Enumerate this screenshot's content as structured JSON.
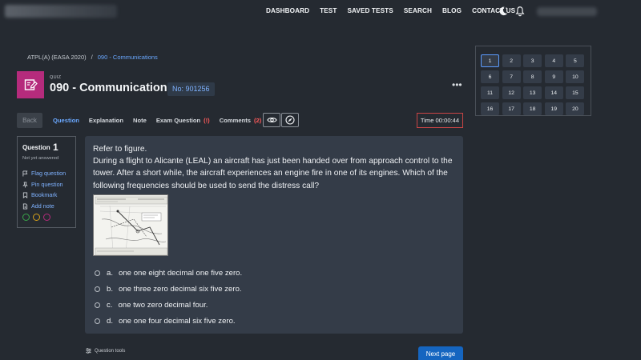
{
  "nav": {
    "items": [
      "DASHBOARD",
      "TEST",
      "SAVED TESTS",
      "SEARCH",
      "BLOG",
      "CONTACT US"
    ]
  },
  "breadcrumb": {
    "root": "ATPL(A) (EASA 2020)",
    "separator": "/",
    "current": "090 - Communications"
  },
  "quiz": {
    "tag": "QUIZ",
    "title": "090 - Communications",
    "number": "No: 901256"
  },
  "toolbar": {
    "back_label": "Back",
    "tabs": [
      "Question",
      "Explanation",
      "Note",
      "Exam Question",
      "Comments"
    ],
    "exam_question_badge": "(!)",
    "comments_badge": "(2)",
    "timer": "Time 00:00:44"
  },
  "question_info": {
    "label": "Question",
    "number": "1",
    "status": "Not yet answered",
    "links": [
      "Flag question",
      "Pin question",
      "Bookmark",
      "Add note"
    ],
    "circle_colors": [
      "#3aa64a",
      "#d8a21a",
      "#b52b7c"
    ]
  },
  "question": {
    "lines": [
      "Refer to figure.",
      "During a flight to Alicante (LEAL) an aircraft has just been handed over from approach control to the tower. After a short while, the aircraft experiences an engine fire in one of its engines. Which of the following frequencies should be used to send the distress call?"
    ],
    "answers": [
      {
        "letter": "a.",
        "text": "one one eight decimal one five zero."
      },
      {
        "letter": "b.",
        "text": "one three zero decimal six five zero."
      },
      {
        "letter": "c.",
        "text": "one two zero decimal four."
      },
      {
        "letter": "d.",
        "text": "one one four decimal six five zero."
      }
    ]
  },
  "footer": {
    "tools_label": "Question tools",
    "next_label": "Next page"
  },
  "navigator": {
    "numbers": [
      "1",
      "2",
      "3",
      "4",
      "5",
      "6",
      "7",
      "8",
      "9",
      "10",
      "11",
      "12",
      "13",
      "14",
      "15",
      "16",
      "17",
      "18",
      "19",
      "20"
    ],
    "current": "1"
  },
  "colors": {
    "accent": "#6aa8ff",
    "quiz_icon": "#b52b7c",
    "timer_border": "#c94545",
    "next_button": "#1565c0"
  }
}
